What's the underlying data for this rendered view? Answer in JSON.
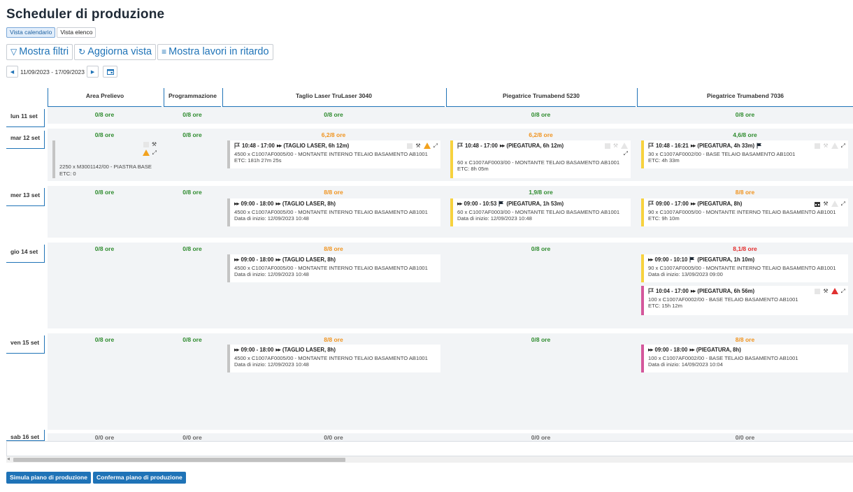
{
  "app": {
    "title": "Scheduler di produzione",
    "view_tabs": [
      "Vista calendario",
      "Vista elenco"
    ],
    "active_view": "Vista calendario"
  },
  "toolbar": {
    "filters": "Mostra filtri",
    "refresh": "Aggiorna vista",
    "late_jobs": "Mostra lavori in ritardo"
  },
  "date_nav": {
    "range": "11/09/2023 - 17/09/2023"
  },
  "columns": [
    "Area Prelievo",
    "Programmazione",
    "Taglio Laser TruLaser 3040",
    "Piegatrice Trumabend 5230",
    "Piegatrice Trumabend 7036"
  ],
  "days": [
    {
      "label": "lun 11 set",
      "hours": [
        "0/8 ore",
        "0/8 ore",
        "0/8 ore",
        "0/8 ore",
        "0/8 ore"
      ]
    },
    {
      "label": "mar 12 set",
      "hours": [
        "0/8 ore",
        "0/8 ore",
        "6,2/8 ore",
        "6,2/8 ore",
        "4,6/8 ore"
      ]
    },
    {
      "label": "mer 13 set",
      "hours": [
        "0/8 ore",
        "0/8 ore",
        "8/8 ore",
        "1,9/8 ore",
        "8/8 ore"
      ]
    },
    {
      "label": "gio 14 set",
      "hours": [
        "0/8 ore",
        "0/8 ore",
        "8/8 ore",
        "0/8 ore",
        "8,1/8 ore"
      ]
    },
    {
      "label": "ven 15 set",
      "hours": [
        "0/8 ore",
        "0/8 ore",
        "8/8 ore",
        "0/8 ore",
        "8/8 ore"
      ]
    },
    {
      "label": "sab 16 set",
      "hours": [
        "0/0 ore",
        "0/0 ore",
        "0/0 ore",
        "0/0 ore",
        "0/0 ore"
      ]
    }
  ],
  "cards": {
    "c1": {
      "desc": "2250 x M3001142/00 - PIASTRA BASE",
      "etc": "ETC: 0"
    },
    "c2": {
      "time": "10:48 - 17:00",
      "op": "(TAGLIO LASER, 6h 12m)",
      "desc": "4500 x C1007AF0005/00 - MONTANTE INTERNO TELAIO BASAMENTO AB1001",
      "etc": "ETC: 181h 27m 25s"
    },
    "c3": {
      "time": "10:48 - 17:00",
      "op": "(PIEGATURA, 6h 12m)",
      "desc": "60 x C1007AF0003/00 - MONTANTE TELAIO BASAMENTO AB1001",
      "etc": "ETC: 8h 05m"
    },
    "c4": {
      "time": "10:48 - 16:21",
      "op": "(PIEGATURA, 4h 33m)",
      "desc": "30 x C1007AF0002/00 - BASE TELAIO BASAMENTO AB1001",
      "etc": "ETC: 4h 33m"
    },
    "c5": {
      "time": "09:00 - 18:00",
      "op": "(TAGLIO LASER, 8h)",
      "desc": "4500 x C1007AF0005/00 - MONTANTE INTERNO TELAIO BASAMENTO AB1001",
      "etc": "Data di inizio: 12/09/2023 10:48"
    },
    "c6": {
      "time": "09:00 - 10:53",
      "op": "(PIEGATURA, 1h 53m)",
      "desc": "60 x C1007AF0003/00 - MONTANTE TELAIO BASAMENTO AB1001",
      "etc": "Data di inizio: 12/09/2023 10:48"
    },
    "c7": {
      "time": "09:00 - 17:00",
      "op": "(PIEGATURA, 8h)",
      "desc": "90 x C1007AF0005/00 - MONTANTE INTERNO TELAIO BASAMENTO AB1001",
      "etc": "ETC: 9h 10m"
    },
    "c8": {
      "time": "09:00 - 18:00",
      "op": "(TAGLIO LASER, 8h)",
      "desc": "4500 x C1007AF0005/00 - MONTANTE INTERNO TELAIO BASAMENTO AB1001",
      "etc": "Data di inizio: 12/09/2023 10:48"
    },
    "c9": {
      "time": "09:00 - 10:10",
      "op": "(PIEGATURA, 1h 10m)",
      "desc": "90 x C1007AF0005/00 - MONTANTE INTERNO TELAIO BASAMENTO AB1001",
      "etc": "Data di inizio: 13/09/2023 09:00"
    },
    "c10": {
      "time": "10:04 - 17:00",
      "op": "(PIEGATURA, 6h 56m)",
      "desc": "100 x C1007AF0002/00 - BASE TELAIO BASAMENTO AB1001",
      "etc": "ETC: 15h 12m"
    },
    "c11": {
      "time": "09:00 - 18:00",
      "op": "(TAGLIO LASER, 8h)",
      "desc": "4500 x C1007AF0005/00 - MONTANTE INTERNO TELAIO BASAMENTO AB1001",
      "etc": "Data di inizio: 12/09/2023 10:48"
    },
    "c12": {
      "time": "09:00 - 18:00",
      "op": "(PIEGATURA, 8h)",
      "desc": "100 x C1007AF0002/00 - BASE TELAIO BASAMENTO AB1001",
      "etc": "Data di inizio: 14/09/2023 10:04"
    }
  },
  "actions": {
    "simulate": "Simula piano di produzione",
    "confirm": "Conferma piano di produzione"
  },
  "colors": {
    "accent": "#1f73b7",
    "hours_ok": "#2e8b2e",
    "hours_full": "#f0931e",
    "hours_over": "#e22b2b",
    "card_yellow": "#f7d23e",
    "card_pink": "#d4579b",
    "card_grey": "#c4c4c4"
  }
}
